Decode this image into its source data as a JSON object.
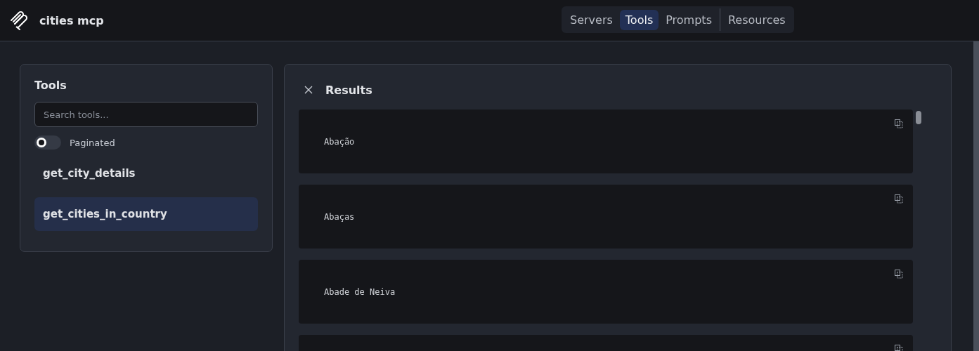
{
  "app": {
    "title": "cities mcp"
  },
  "nav_tabs": [
    {
      "label": "Servers",
      "selected": false
    },
    {
      "label": "Tools",
      "selected": true
    },
    {
      "label": "Prompts",
      "selected": false
    },
    {
      "label": "Resources",
      "selected": false
    }
  ],
  "tools_panel": {
    "title": "Tools",
    "search": {
      "placeholder": "Search tools..."
    },
    "paginated": {
      "label": "Paginated",
      "on": false
    },
    "items": [
      {
        "label": "get_city_details",
        "selected": false
      },
      {
        "label": "get_cities_in_country",
        "selected": true
      }
    ]
  },
  "results_panel": {
    "title": "Results",
    "results": [
      "Abação",
      "Abaças",
      "Abade de Neiva"
    ]
  }
}
